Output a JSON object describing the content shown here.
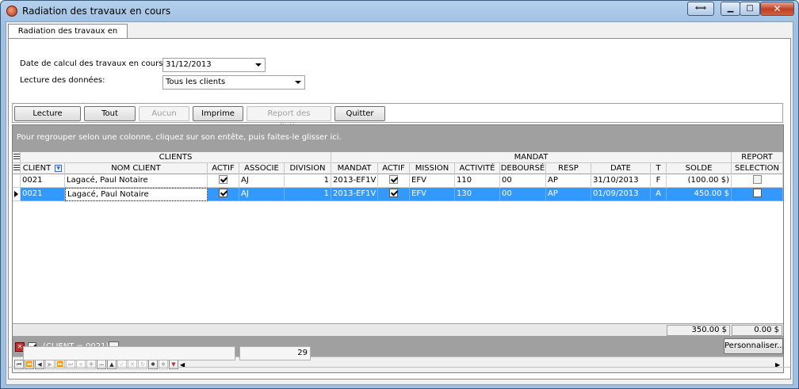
{
  "window": {
    "title": "Radiation des travaux en cours",
    "controls": [
      "restore-arrows",
      "minimize",
      "maximize",
      "close"
    ]
  },
  "tab": {
    "label": "Radiation des travaux en cours"
  },
  "form": {
    "date_label": "Date de calcul des travaux en cours:",
    "date_value": "31/12/2013",
    "lecture_label": "Lecture des données:",
    "lecture_value": "Tous les clients"
  },
  "toolbar": {
    "lecture": "Lecture",
    "tout": "Tout",
    "aucun": "Aucun",
    "imprime": "Imprime",
    "report": "Report des radiations",
    "quitter": "Quitter"
  },
  "grid": {
    "group_hint": "Pour regrouper selon une colonne, cliquez sur son entête, puis faites-le glisser ici.",
    "bands": {
      "clients": "CLIENTS",
      "mandat": "MANDAT",
      "report": "REPORT"
    },
    "columns": [
      "CLIENT",
      "NOM CLIENT",
      "ACTIF",
      "ASSOCIE",
      "DIVISION",
      "MANDAT",
      "ACTIF",
      "MISSION",
      "ACTIVITÉ",
      "DEBOURSÉ",
      "RESP",
      "DATE",
      "T",
      "SOLDE",
      "SELECTION"
    ],
    "rows": [
      {
        "client": "0021",
        "nom": "Lagacé, Paul Notaire",
        "actif": true,
        "associe": "AJ",
        "division": "1",
        "mandat": "2013-EF1V",
        "actif2": true,
        "mission": "EFV",
        "activite": "110",
        "debourse": "00",
        "resp": "AP",
        "date": "31/10/2013",
        "t": "F",
        "solde": "(100.00 $)",
        "selection": false
      },
      {
        "client": "0021",
        "nom": "Lagacé, Paul Notaire",
        "actif": true,
        "associe": "AJ",
        "division": "1",
        "mandat": "2013-EF1V",
        "actif2": true,
        "mission": "EFV",
        "activite": "130",
        "debourse": "00",
        "resp": "AP",
        "date": "01/09/2013",
        "t": "A",
        "solde": "450.00 $",
        "selection": false
      }
    ],
    "totals": {
      "solde": "350.00 $",
      "selection": "0.00 $"
    },
    "filter": {
      "text": "(CLIENT = 0021)",
      "button": "Personnaliser..."
    }
  },
  "status": {
    "count": "29"
  },
  "colors": {
    "selection": "#3399ff",
    "group_area": "#a0a0a0"
  }
}
